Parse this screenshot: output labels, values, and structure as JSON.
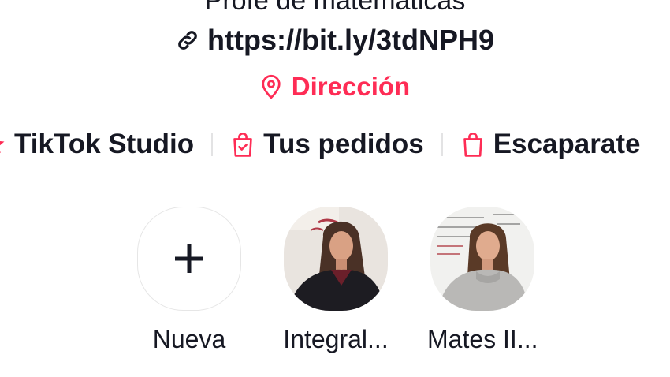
{
  "profile": {
    "bio_line": "Profe de matemáticas",
    "link": {
      "text": "https://bit.ly/3tdNPH9",
      "icon": "link-icon"
    },
    "location": {
      "text": "Dirección",
      "icon": "location-pin-icon",
      "color": "#fe2c55"
    }
  },
  "shortcuts": [
    {
      "label": "TikTok Studio",
      "icon": "star-icon"
    },
    {
      "label": "Tus pedidos",
      "icon": "shopping-bag-check-icon"
    },
    {
      "label": "Escaparate",
      "icon": "shopping-bag-icon"
    }
  ],
  "stories": [
    {
      "label": "Nueva",
      "icon": "plus-icon"
    },
    {
      "label": "Integral...",
      "thumbnail": "story-thumbnail"
    },
    {
      "label": "Mates II...",
      "thumbnail": "story-thumbnail"
    }
  ],
  "colors": {
    "accent": "#fe2c55",
    "text": "#161823"
  }
}
